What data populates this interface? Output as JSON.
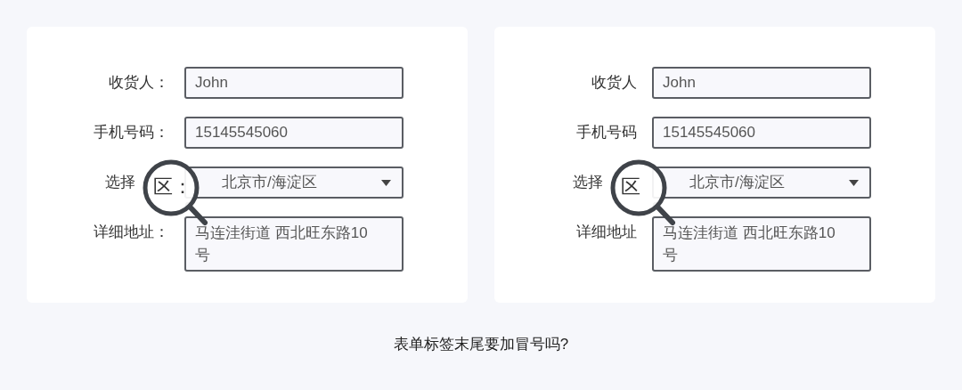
{
  "forms": [
    {
      "fields": [
        {
          "kind": "text",
          "label": "收货人：",
          "value": "John"
        },
        {
          "kind": "text",
          "label": "手机号码：",
          "value": "15145545060"
        },
        {
          "kind": "select",
          "label": "选择",
          "value": "北京市/海淀区",
          "magnifier": "区："
        },
        {
          "kind": "textarea",
          "label": "详细地址：",
          "value": "马连洼街道 西北旺东路10号"
        }
      ]
    },
    {
      "fields": [
        {
          "kind": "text",
          "label": "收货人",
          "value": "John"
        },
        {
          "kind": "text",
          "label": "手机号码",
          "value": "15145545060"
        },
        {
          "kind": "select",
          "label": "选择",
          "value": "北京市/海淀区",
          "magnifier": "区"
        },
        {
          "kind": "textarea",
          "label": "详细地址",
          "value": "马连洼街道 西北旺东路10号"
        }
      ]
    }
  ],
  "caption": "表单标签末尾要加冒号吗?"
}
